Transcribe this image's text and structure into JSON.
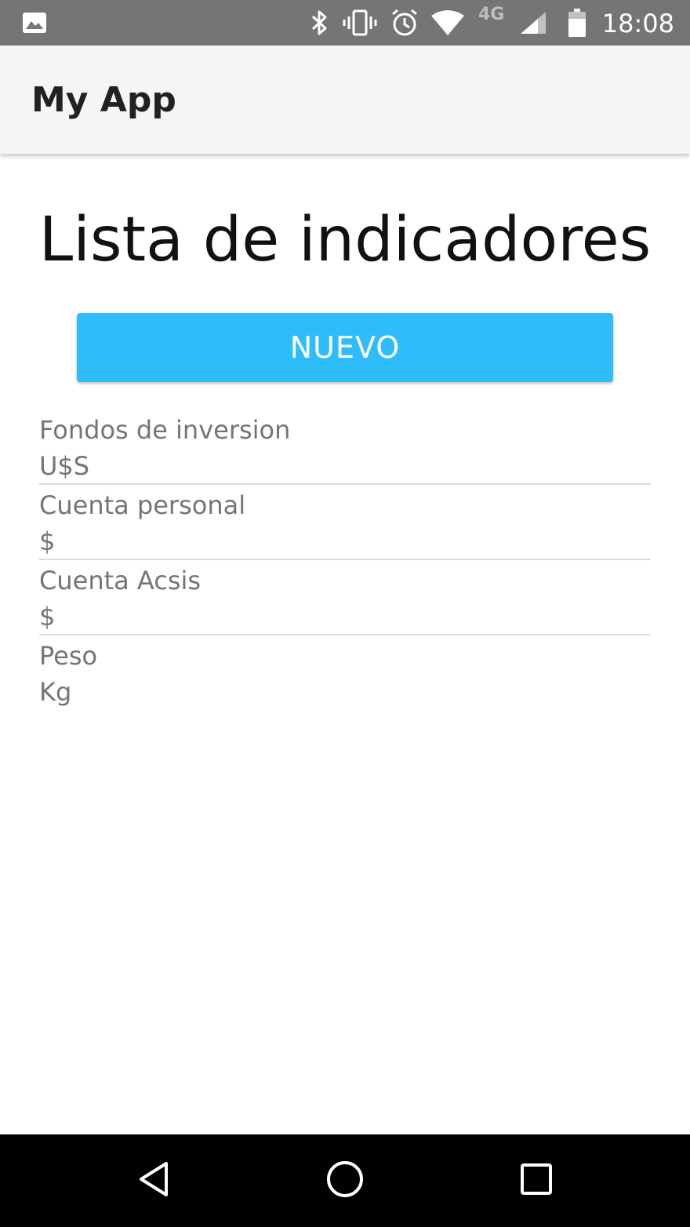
{
  "status_bar": {
    "time": "18:08",
    "network_label": "4G",
    "icons": [
      "image-icon",
      "bluetooth-icon",
      "vibrate-icon",
      "alarm-icon",
      "wifi-icon",
      "signal-icon",
      "battery-icon"
    ]
  },
  "app_bar": {
    "title": "My App"
  },
  "main": {
    "heading": "Lista de indicadores",
    "new_button_label": "NUEVO",
    "indicators": [
      {
        "name": "Fondos de inversion",
        "unit": "U$S"
      },
      {
        "name": "Cuenta personal",
        "unit": "$"
      },
      {
        "name": "Cuenta Acsis",
        "unit": "$"
      },
      {
        "name": "Peso",
        "unit": "Kg"
      }
    ]
  },
  "nav_bar": {
    "icons": [
      "back-icon",
      "home-icon",
      "recents-icon"
    ]
  },
  "colors": {
    "status_bar": "#757575",
    "app_bar": "#f5f5f5",
    "accent": "#2fbcfa",
    "nav_bar": "#000000"
  }
}
